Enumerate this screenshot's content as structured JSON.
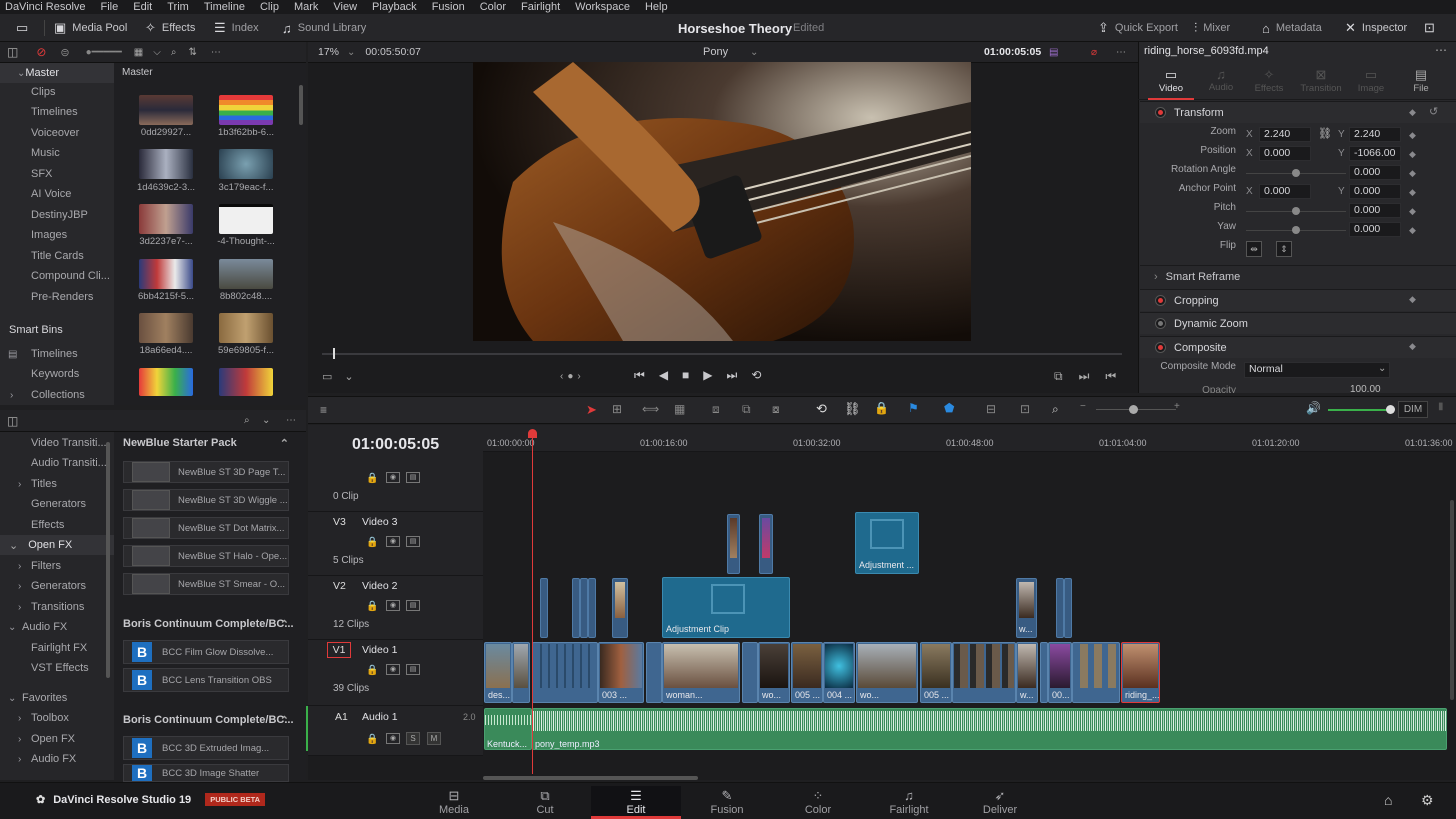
{
  "menu": [
    "DaVinci Resolve",
    "File",
    "Edit",
    "Trim",
    "Timeline",
    "Clip",
    "Mark",
    "View",
    "Playback",
    "Fusion",
    "Color",
    "Fairlight",
    "Workspace",
    "Help"
  ],
  "toolbar": {
    "media_pool": "Media Pool",
    "effects": "Effects",
    "index": "Index",
    "sound_library": "Sound Library",
    "project_title": "Horseshoe Theory",
    "project_status": "Edited",
    "quick_export": "Quick Export",
    "mixer": "Mixer",
    "metadata": "Metadata",
    "inspector": "Inspector"
  },
  "mediapool": {
    "header": "Master",
    "bins": [
      "Master",
      "Clips",
      "Timelines",
      "Voiceover",
      "Music",
      "SFX",
      "AI Voice",
      "DestinyJBP",
      "Images",
      "Title Cards",
      "Compound Cli...",
      "Pre-Renders"
    ],
    "smart_bins_title": "Smart Bins",
    "smart_bins": [
      "Timelines",
      "Keywords",
      "Collections"
    ],
    "clips": [
      "0dd29927...",
      "1b3f62bb-6...",
      "1d4639c2-3...",
      "3c179eac-f...",
      "3d2237e7-...",
      "-4-Thought-...",
      "6bb4215f-5...",
      "8b802c48....",
      "18a66ed4....",
      "59e69805-f..."
    ]
  },
  "viewer": {
    "zoom": "17%",
    "source_tc": "00:05:50:07",
    "timeline_name": "Pony",
    "record_tc": "01:00:05:05"
  },
  "inspector": {
    "clip_name": "riding_horse_6093fd.mp4",
    "tabs": [
      "Video",
      "Audio",
      "Effects",
      "Transition",
      "Image",
      "File"
    ],
    "transform_title": "Transform",
    "zoom_label": "Zoom",
    "zoom_x": "2.240",
    "zoom_y": "2.240",
    "position_label": "Position",
    "pos_x": "0.000",
    "pos_y": "-1066.00",
    "rotation_label": "Rotation Angle",
    "rotation": "0.000",
    "anchor_label": "Anchor Point",
    "anchor_x": "0.000",
    "anchor_y": "0.000",
    "pitch_label": "Pitch",
    "pitch": "0.000",
    "yaw_label": "Yaw",
    "yaw": "0.000",
    "flip_label": "Flip",
    "x": "X",
    "y": "Y",
    "smart_reframe": "Smart Reframe",
    "cropping": "Cropping",
    "dynamic_zoom": "Dynamic Zoom",
    "composite": "Composite",
    "composite_mode_label": "Composite Mode",
    "composite_mode": "Normal",
    "opacity_label": "Opacity",
    "opacity": "100.00"
  },
  "effects": {
    "categories": [
      "Video Transiti...",
      "Audio Transiti...",
      "Titles",
      "Generators",
      "Effects",
      "Open FX",
      "Filters",
      "Generators",
      "Transitions",
      "Audio FX",
      "Fairlight FX",
      "VST Effects",
      "Favorites",
      "Toolbox",
      "Open FX",
      "Audio FX"
    ],
    "group1": "NewBlue Starter Pack",
    "newblue": [
      "NewBlue ST 3D Page T...",
      "NewBlue ST 3D Wiggle ...",
      "NewBlue ST Dot Matrix...",
      "NewBlue ST Halo - Ope...",
      "NewBlue ST Smear - O..."
    ],
    "group2": "Boris Continuum Complete/BC...",
    "bcc1": [
      "BCC Film Glow Dissolve...",
      "BCC Lens Transition OBS"
    ],
    "group3": "Boris Continuum Complete/BC...",
    "bcc2": [
      "BCC 3D Extruded Imag...",
      "BCC 3D Image Shatter"
    ]
  },
  "timeline": {
    "timecode": "01:00:05:05",
    "ruler": [
      "01:00:00:00",
      "01:00:16:00",
      "01:00:32:00",
      "01:00:48:00",
      "01:01:04:00",
      "01:01:20:00",
      "01:01:36:00"
    ],
    "tracks": [
      {
        "id": "",
        "name": "",
        "count": "0 Clip"
      },
      {
        "id": "V3",
        "name": "Video 3",
        "count": "5 Clips"
      },
      {
        "id": "V2",
        "name": "Video 2",
        "count": "12 Clips"
      },
      {
        "id": "V1",
        "name": "Video 1",
        "count": "39 Clips"
      }
    ],
    "audio": {
      "id": "A1",
      "name": "Audio 1",
      "level": "2.0",
      "s": "S",
      "m": "M"
    },
    "adjustment_v3": "Adjustment ...",
    "adjustment_v2": "Adjustment Clip",
    "v2_small": "w...",
    "v1_clips": [
      "des...",
      "003 ...",
      "woman...",
      "wo...",
      "005 ...",
      "004 ...",
      "wo...",
      "005 ...",
      "w...",
      "00...",
      "riding_..."
    ],
    "audio_clips": [
      "Kentuck...",
      "pony_temp.mp3"
    ],
    "dim": "DIM"
  },
  "pages": [
    "Media",
    "Cut",
    "Edit",
    "Fusion",
    "Color",
    "Fairlight",
    "Deliver"
  ],
  "brand": "DaVinci Resolve Studio 19",
  "beta": "PUBLIC BETA"
}
